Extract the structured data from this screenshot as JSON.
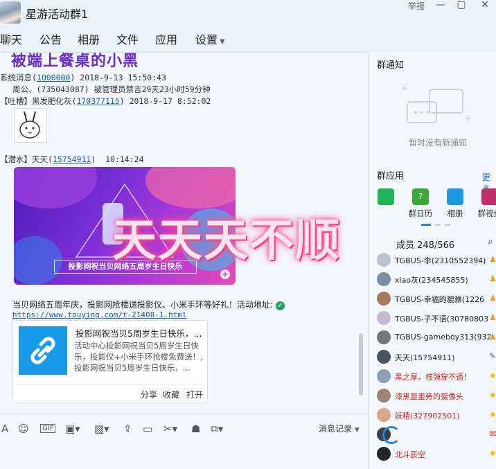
{
  "window": {
    "title": "星游活动群1",
    "report_label": "举报",
    "minimize_glyph": "—",
    "maximize_glyph": "▢",
    "close_glyph": "✕"
  },
  "tabs": [
    "聊天",
    "公告",
    "相册",
    "文件",
    "应用",
    "设置"
  ],
  "chat": {
    "banner_partial": "被端上餐桌的小黑",
    "system_line": {
      "sender": "系统消息",
      "id": "1000000",
      "time": "2018-9-13 15:50:43"
    },
    "mute_notice": "周公、(735043087) 被管理员禁言29天23小时59分钟",
    "msg1": {
      "tag": "【吐槽】",
      "name": "黑发肥化灰",
      "id": "170377115",
      "time": "2018-9-17 8:52:02"
    },
    "msg2": {
      "tag": "【潜水】",
      "name": "天天",
      "id": "15754911",
      "time": "10:14:24"
    },
    "promo_caption": "投影网祝当贝网络五周岁生日快乐",
    "overlay_text": "天天天不顺",
    "share_text": "当贝网络五周年庆，投影网抢楼送投影仪、小米手环等好礼！活动地址:",
    "share_url": "https://www.touying.com/t-21408-1.html",
    "card": {
      "title": "投影网祝当贝5周岁生日快乐，...",
      "desc": "活动中心投影网祝当贝5周岁生日快乐，投影仪+小米手环抢楼免费送！,投影网祝当贝5周岁生日快乐，...",
      "actions": [
        "分享",
        "收藏",
        "打开"
      ]
    }
  },
  "toolbar": {
    "history_label": "消息记录"
  },
  "right_panel": {
    "notice_title": "群通知",
    "notice_empty": "暂时没有新通知",
    "apps_title": "群应用",
    "more_label": "更多",
    "apps": [
      "",
      "群日历",
      "相册",
      "群视频"
    ],
    "members_title": "成员 248/566",
    "members": [
      "TGBUS-李(2310552394)",
      "xiao灰(234545855)",
      "TGBUS-幸福的貔貅(1226",
      "TGBUS-子不语(30780803",
      "TGBUS-gameboy313(932",
      "天天(15754911)",
      "黑之厚，核弹穿不透！",
      "漆黑噩噩旁的摄像头",
      "妖精(327902501)",
      "",
      "北斗辰空"
    ]
  },
  "colors": {
    "accent": "#1e88e5",
    "promo_purple": "#6a2bc6",
    "overlay_pink": "#ff4d8d"
  }
}
